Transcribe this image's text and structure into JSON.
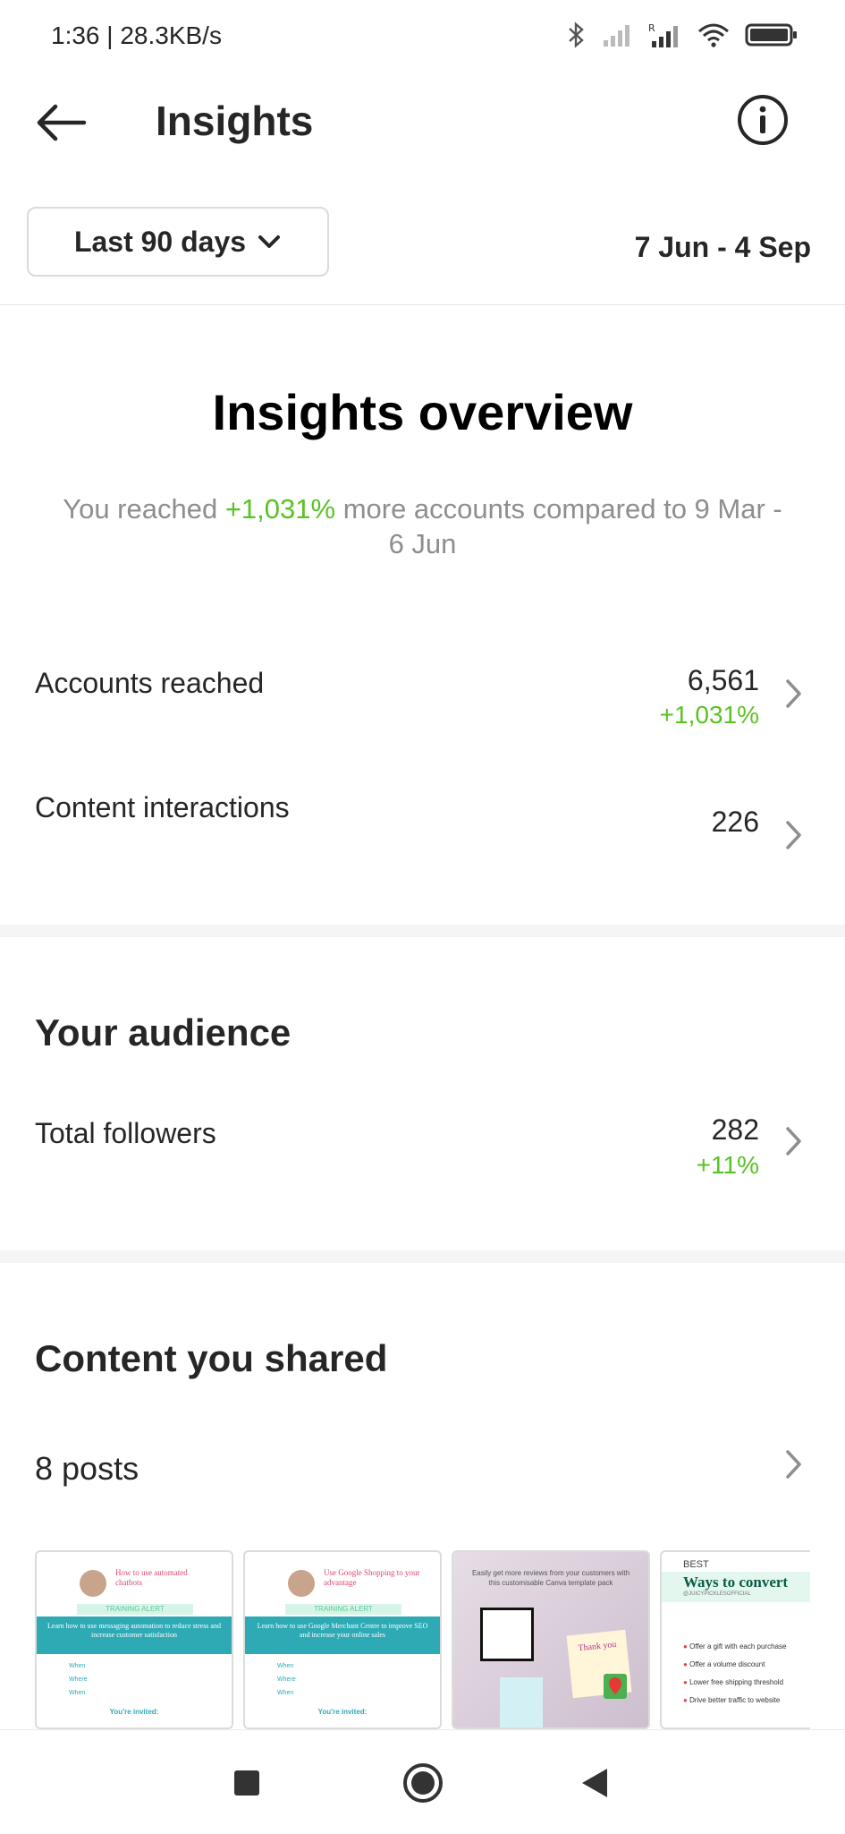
{
  "status_bar": {
    "time": "1:36 | 28.3KB/s"
  },
  "header": {
    "title": "Insights"
  },
  "filter": {
    "range_label": "Last 90 days",
    "date_range": "7 Jun - 4 Sep"
  },
  "overview": {
    "title": "Insights overview",
    "sub_prefix": "You reached ",
    "sub_highlight": "+1,031%",
    "sub_suffix": " more accounts compared to 9 Mar - 6 Jun",
    "rows": [
      {
        "label": "Accounts reached",
        "value": "6,561",
        "delta": "+1,031%"
      },
      {
        "label": "Content interactions",
        "value": "226"
      }
    ]
  },
  "audience": {
    "title": "Your audience",
    "rows": [
      {
        "label": "Total followers",
        "value": "282",
        "delta": "+11%"
      }
    ]
  },
  "content": {
    "title": "Content you shared",
    "posts_label": "8 posts",
    "thumbnails": [
      {
        "heading": "How to use automated chatbots",
        "banner": "TRAINING ALERT",
        "body": "Learn how to use messaging automation to reduce stress and increase customer satisfaction",
        "rows": [
          "When",
          "Where",
          "When"
        ],
        "footer": "You're invited:",
        "accent": "#2eaab5"
      },
      {
        "heading": "Use Google Shopping to your advantage",
        "banner": "TRAINING ALERT",
        "body": "Learn how to use Google Merchant Centre to improve SEO and increase your online sales",
        "rows": [
          "When",
          "Where",
          "When"
        ],
        "footer": "You're invited:",
        "accent": "#2eaab5"
      },
      {
        "heading": "Easily get more reviews from your customers with this customisable Canva template pack",
        "card_text": "Thank you",
        "accent": "#d8c9d6"
      },
      {
        "tag": "BEST",
        "heading": "Ways to convert",
        "handle": "@JUICYPICKLESOFFICIAL",
        "items": [
          "Offer a gift with each purchase",
          "Offer a volume discount",
          "Lower free shipping threshold",
          "Drive better traffic to website"
        ],
        "accent": "#e0454f"
      }
    ]
  },
  "colors": {
    "accent_green": "#58c322",
    "text_primary": "#262626",
    "text_secondary": "#8e8e8e"
  }
}
